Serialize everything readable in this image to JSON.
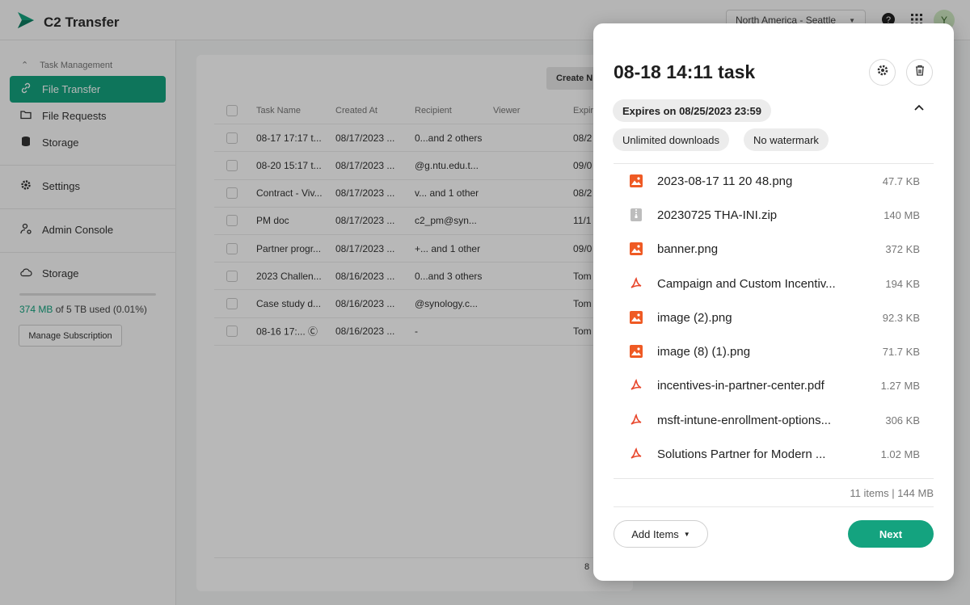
{
  "app": {
    "title": "C2 Transfer",
    "region": "North America - Seattle",
    "avatar_initial": "Y",
    "brand_color": "#14a37f"
  },
  "sidebar": {
    "group_title": "Task Management",
    "items": [
      {
        "label": "File Transfer",
        "icon": "link-icon"
      },
      {
        "label": "File Requests",
        "icon": "folder-icon"
      },
      {
        "label": "Storage",
        "icon": "database-icon"
      },
      {
        "label": "Settings",
        "icon": "gear-icon"
      },
      {
        "label": "Admin Console",
        "icon": "admin-icon"
      },
      {
        "label": "Storage",
        "icon": "cloud-icon"
      }
    ],
    "storage_used": "374 MB",
    "storage_rest": " of 5 TB used (0.01%)",
    "manage_label": "Manage Subscription"
  },
  "main": {
    "create_label": "Create N",
    "columns": [
      "Task Name",
      "Created At",
      "Recipient",
      "Viewer",
      "Expir"
    ],
    "rows": [
      {
        "name": "08-17 17:17 t...",
        "created": "08/17/2023 ...",
        "recipient": "0...and 2 others",
        "viewer": "",
        "exp": "08/2"
      },
      {
        "name": "08-20 15:17 t...",
        "created": "08/17/2023 ...",
        "recipient": "@g.ntu.edu.t...",
        "viewer": "",
        "exp": "09/0"
      },
      {
        "name": "Contract - Viv...",
        "created": "08/17/2023 ...",
        "recipient": "v...  and 1 other",
        "viewer": "",
        "exp": "08/2"
      },
      {
        "name": "PM doc",
        "created": "08/17/2023 ...",
        "recipient": "c2_pm@syn...",
        "viewer": "",
        "exp": "11/1"
      },
      {
        "name": "Partner progr...",
        "created": "08/17/2023 ...",
        "recipient": "+...  and 1 other",
        "viewer": "",
        "exp": "09/0"
      },
      {
        "name": "2023 Challen...",
        "created": "08/16/2023 ...",
        "recipient": "0...and 3 others",
        "viewer": "",
        "exp": "Tom"
      },
      {
        "name": "Case study d...",
        "created": "08/16/2023 ...",
        "recipient": "@synology.c...",
        "viewer": "",
        "exp": "Tom"
      },
      {
        "name": "08-16 17:...  Ⓒ",
        "created": "08/16/2023 ...",
        "recipient": "-",
        "viewer": "",
        "exp": "Tom"
      }
    ],
    "footer_num": "8"
  },
  "modal": {
    "title": "08-18 14:11 task",
    "expires": "Expires on 08/25/2023 23:59",
    "chip_downloads": "Unlimited downloads",
    "chip_watermark": "No watermark",
    "files": [
      {
        "name": "2023-08-17 11 20 48.png",
        "size": "47.7 KB",
        "type": "image"
      },
      {
        "name": "20230725 THA-INI.zip",
        "size": "140 MB",
        "type": "zip"
      },
      {
        "name": "banner.png",
        "size": "372 KB",
        "type": "image"
      },
      {
        "name": "Campaign and Custom Incentiv...",
        "size": "194 KB",
        "type": "pdf"
      },
      {
        "name": "image (2).png",
        "size": "92.3 KB",
        "type": "image"
      },
      {
        "name": "image (8) (1).png",
        "size": "71.7 KB",
        "type": "image"
      },
      {
        "name": "incentives-in-partner-center.pdf",
        "size": "1.27 MB",
        "type": "pdf"
      },
      {
        "name": "msft-intune-enrollment-options...",
        "size": "306 KB",
        "type": "pdf"
      },
      {
        "name": "Solutions Partner for Modern ...",
        "size": "1.02 MB",
        "type": "pdf"
      }
    ],
    "summary": "11 items | 144 MB",
    "add_label": "Add Items",
    "next_label": "Next"
  }
}
